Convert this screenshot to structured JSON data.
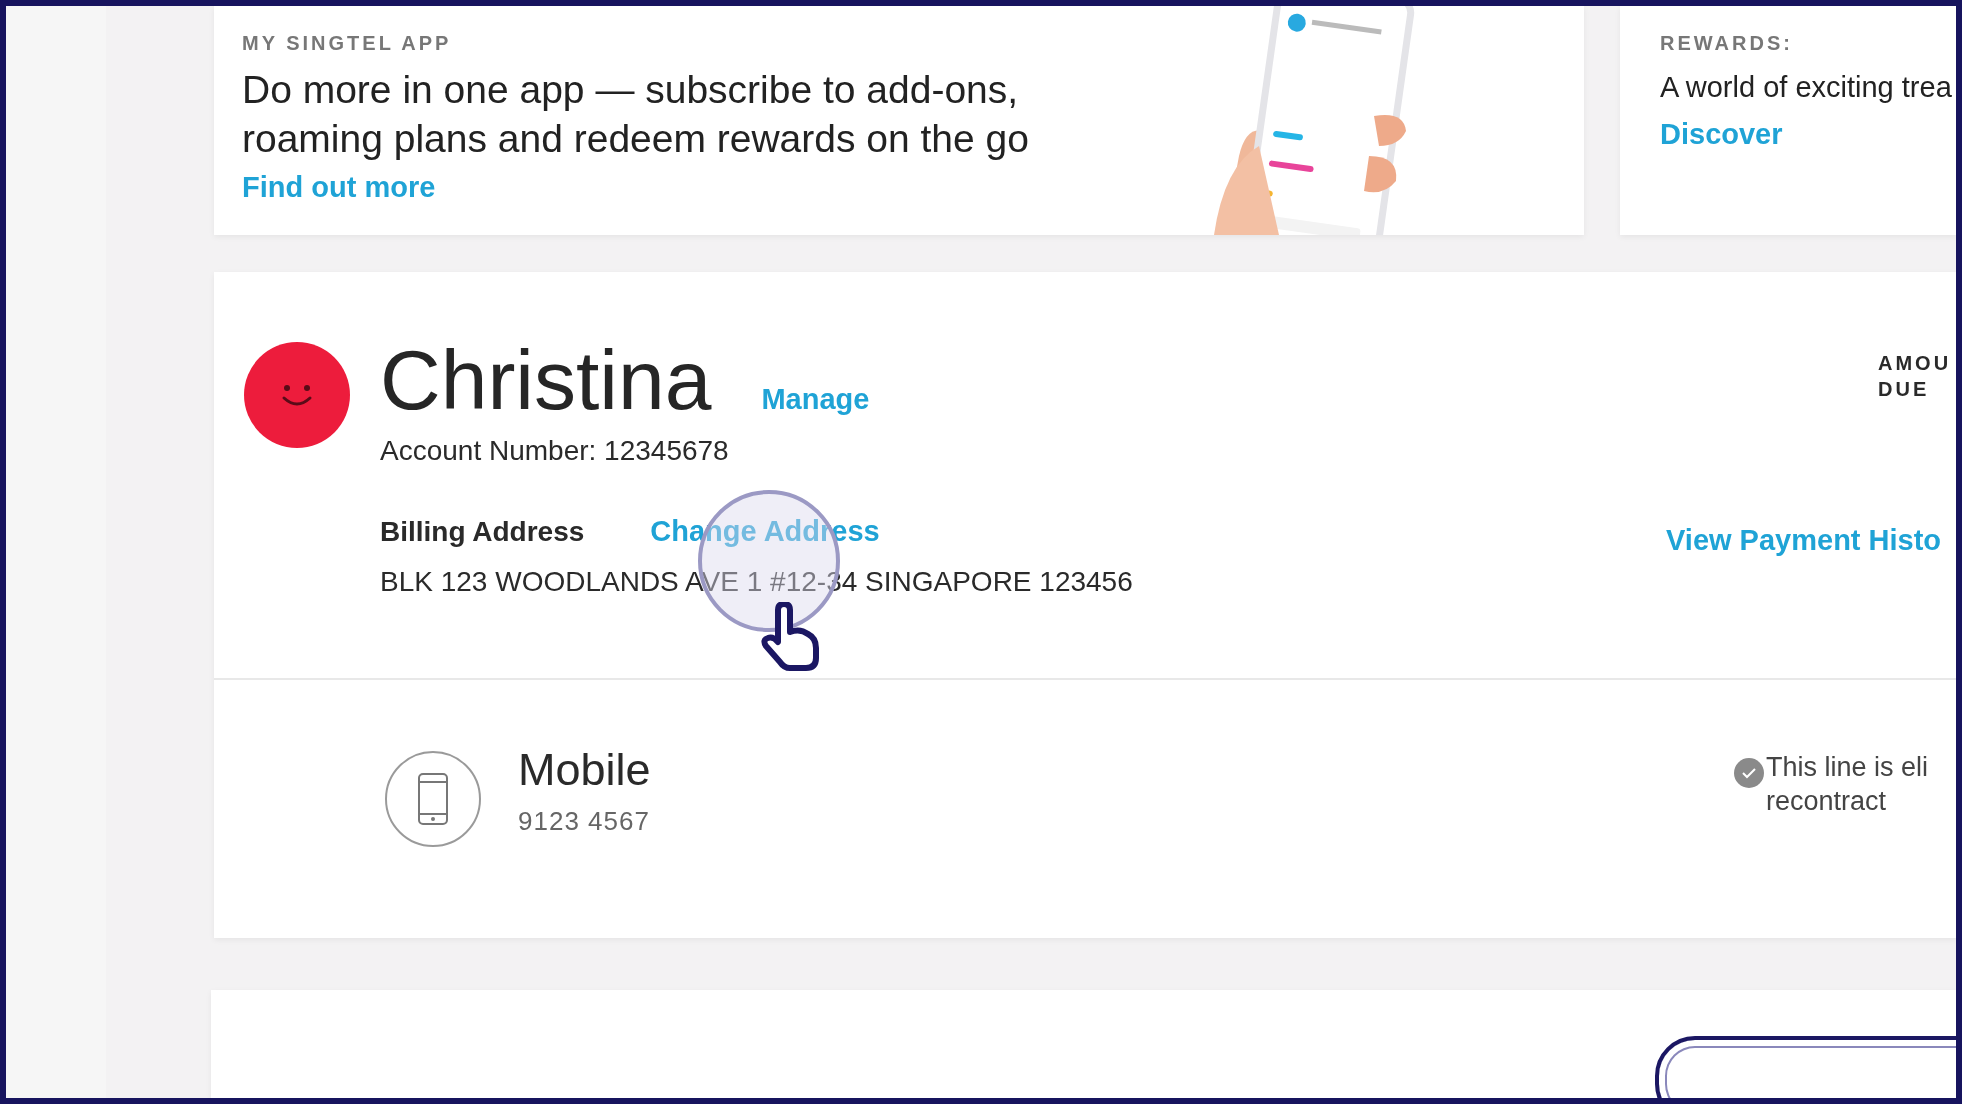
{
  "app_banner": {
    "eyebrow": "MY SINGTEL APP",
    "headline_lines": [
      "Do more in one app — subscribe to add-ons,",
      "roaming plans and redeem rewards on the go"
    ],
    "link": "Find out more"
  },
  "rewards_banner": {
    "eyebrow": "REWARDS:",
    "text": "A world of exciting trea",
    "link": "Discover"
  },
  "account": {
    "name": "Christina",
    "manage_link": "Manage",
    "account_number": "Account Number: 12345678",
    "billing_label": "Billing Address",
    "change_link": "Change Address",
    "address": "BLK 123 WOODLANDS AVE 1 #12-34 SINGAPORE 123456",
    "amount_label_lines": [
      "AMOU",
      "DUE"
    ],
    "payment_history_link": "View Payment Histo"
  },
  "line": {
    "type": "Mobile",
    "number": "9123 4567",
    "eligibility_lines": [
      "This line is eli",
      "recontract"
    ],
    "eligible": true
  }
}
